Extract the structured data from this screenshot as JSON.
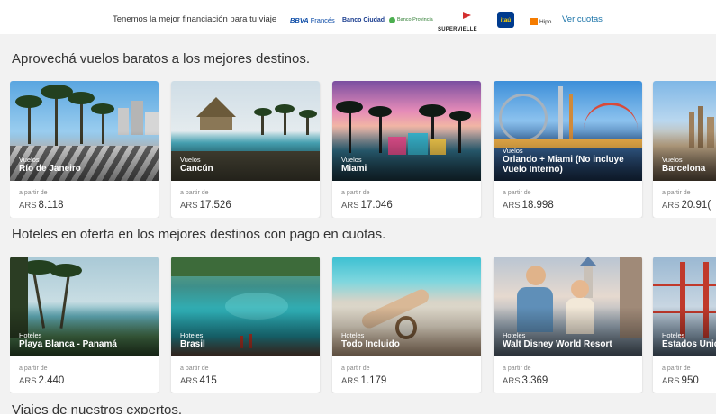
{
  "promo": {
    "text": "Tenemos la mejor financiación para tu viaje",
    "banks": {
      "bbva": "BBVA",
      "bbva_suffix": "Francés",
      "ciudad": "Banco Ciudad",
      "provincia": "Banco Provincia",
      "supervielle": "SUPERVIELLE",
      "itau": "itaú",
      "hipotecario": "Hipo"
    },
    "link_label": "Ver cuotas"
  },
  "flights": {
    "title": "Aprovechá vuelos baratos a los mejores destinos.",
    "from_label": "a partir de",
    "currency": "ARS",
    "items": [
      {
        "category": "Vuelos",
        "destination": "Río de Janeiro",
        "price": "8.118"
      },
      {
        "category": "Vuelos",
        "destination": "Cancún",
        "price": "17.526"
      },
      {
        "category": "Vuelos",
        "destination": "Miami",
        "price": "17.046"
      },
      {
        "category": "Vuelos",
        "destination": "Orlando + Miami (No incluye Vuelo Interno)",
        "price": "18.998"
      },
      {
        "category": "Vuelos",
        "destination": "Barcelona",
        "price": "20.91("
      }
    ]
  },
  "hotels": {
    "title": "Hoteles en oferta en los mejores destinos con pago en cuotas.",
    "from_label": "a partir de",
    "currency": "ARS",
    "items": [
      {
        "category": "Hoteles",
        "destination": "Playa Blanca - Panamá",
        "price": "2.440"
      },
      {
        "category": "Hoteles",
        "destination": "Brasil",
        "price": "415"
      },
      {
        "category": "Hoteles",
        "destination": "Todo Incluido",
        "price": "1.179"
      },
      {
        "category": "Hoteles",
        "destination": "Walt Disney World Resort",
        "price": "3.369"
      },
      {
        "category": "Hoteles",
        "destination": "Estados Unid",
        "price": "950"
      }
    ]
  },
  "experts": {
    "title": "Viajes de nuestros expertos."
  }
}
